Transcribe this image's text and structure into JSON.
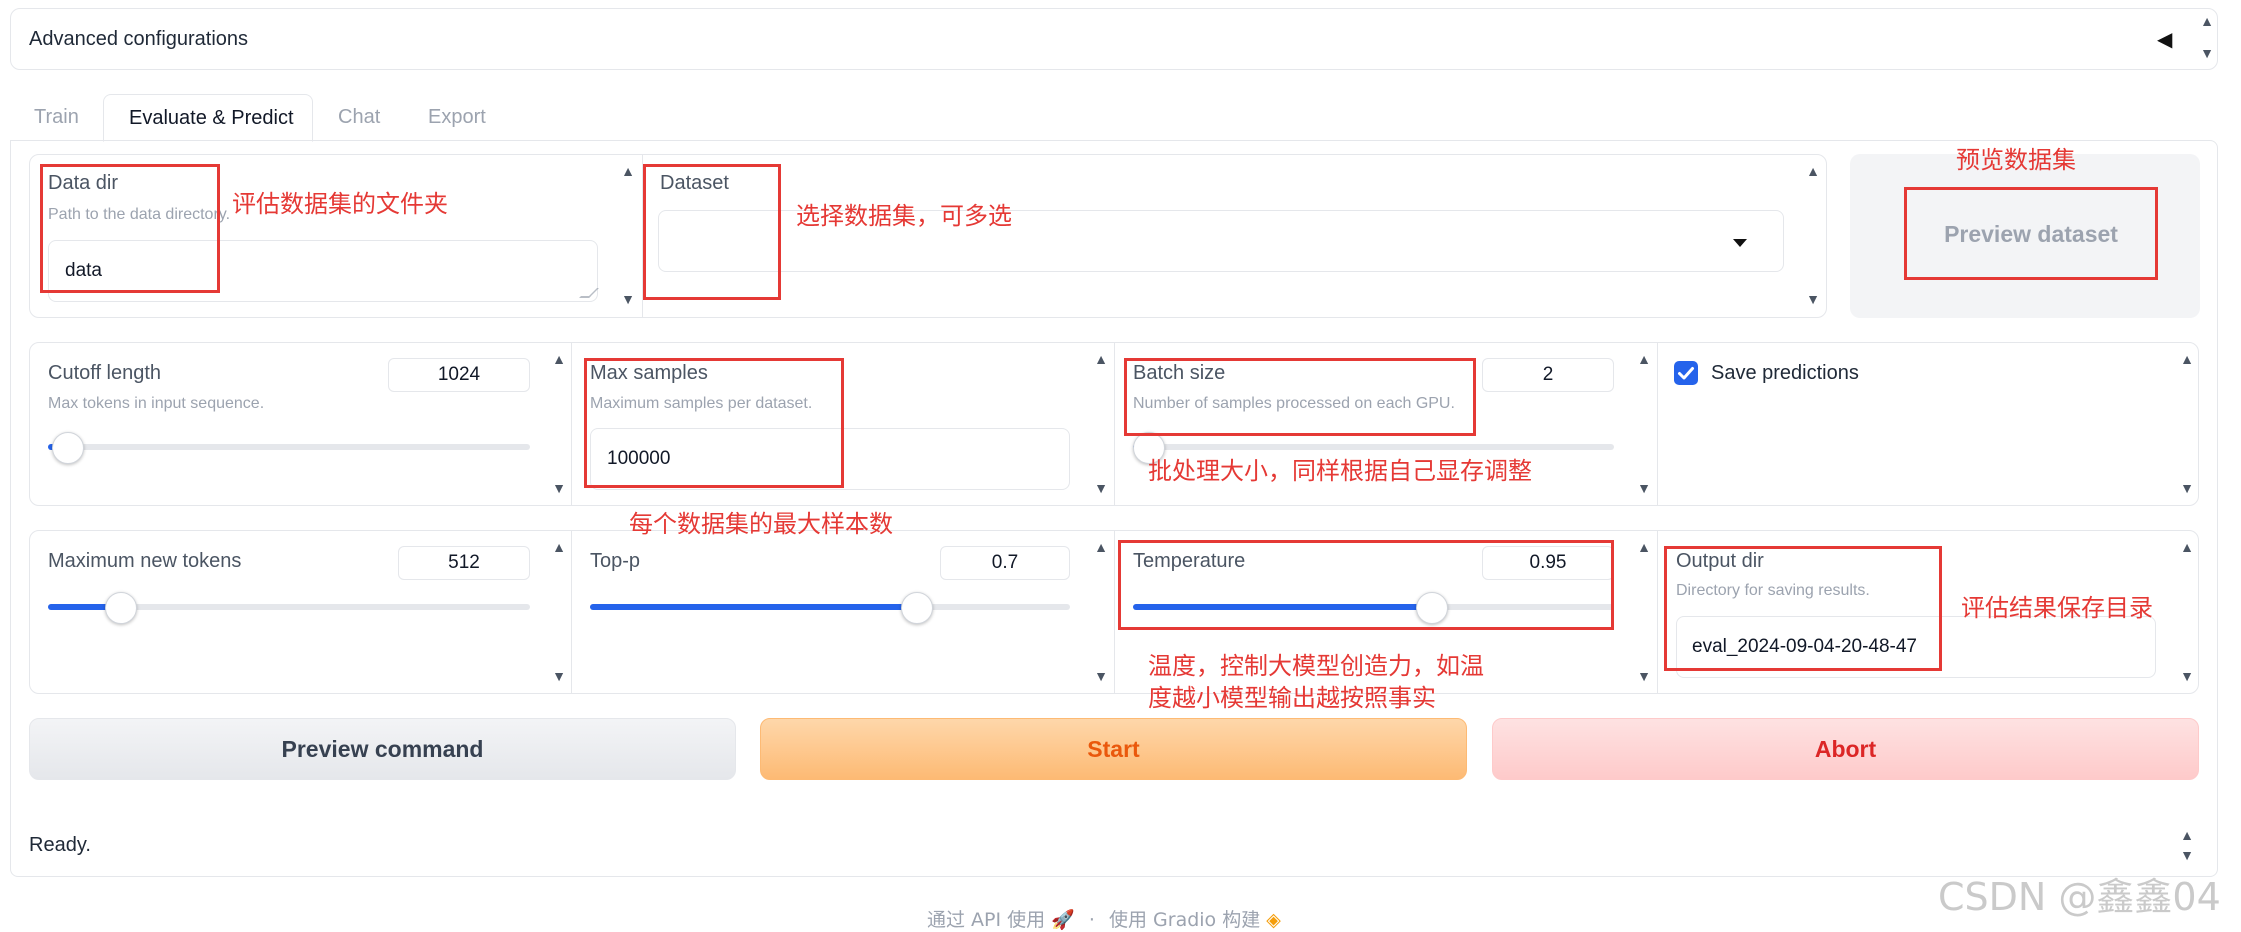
{
  "accordion": {
    "title": "Advanced configurations",
    "collapse_icon": "◀"
  },
  "tabs": [
    {
      "label": "Train",
      "active": false
    },
    {
      "label": "Evaluate & Predict",
      "active": true
    },
    {
      "label": "Chat",
      "active": false
    },
    {
      "label": "Export",
      "active": false
    }
  ],
  "row1": {
    "data_dir": {
      "label": "Data dir",
      "info": "Path to the data directory.",
      "value": "data"
    },
    "dataset": {
      "label": "Dataset",
      "value": ""
    },
    "preview_dataset": {
      "label": "Preview dataset"
    }
  },
  "row2": {
    "cutoff_len": {
      "label": "Cutoff length",
      "info": "Max tokens in input sequence.",
      "value": "1024",
      "fraction": 0.04
    },
    "max_samples": {
      "label": "Max samples",
      "info": "Maximum samples per dataset.",
      "value": "100000"
    },
    "batch_size": {
      "label": "Batch size",
      "info": "Number of samples processed on each GPU.",
      "value": "2",
      "fraction": 0.03
    },
    "save_predictions": {
      "label": "Save predictions",
      "checked": true
    }
  },
  "row3": {
    "max_new_tokens": {
      "label": "Maximum new tokens",
      "value": "512",
      "fraction": 0.15
    },
    "top_p": {
      "label": "Top-p",
      "value": "0.7",
      "fraction": 0.68
    },
    "temperature": {
      "label": "Temperature",
      "value": "0.95",
      "fraction": 0.62
    },
    "output_dir": {
      "label": "Output dir",
      "info": "Directory for saving results.",
      "value": "eval_2024-09-04-20-48-47"
    }
  },
  "buttons": {
    "preview_command": "Preview command",
    "start": "Start",
    "abort": "Abort"
  },
  "status": "Ready.",
  "footer": {
    "api": "通过 API 使用",
    "sep": "·",
    "built": "使用 Gradio 构建"
  },
  "annotations": {
    "data_dir": "评估数据集的文件夹",
    "dataset": "选择数据集，可多选",
    "preview": "预览数据集",
    "max_samples": "每个数据集的最大样本数",
    "batch_size": "批处理大小，同样根据自己显存调整",
    "temperature_1": "温度，控制大模型创造力，如温",
    "temperature_2": "度越小模型输出越按照事实",
    "output_dir": "评估结果保存目录"
  },
  "watermark": "CSDN @鑫鑫04",
  "colors": {
    "accent": "#2563eb",
    "annotation": "#e53935",
    "start_text": "#ea580c",
    "abort_text": "#dc2626"
  }
}
